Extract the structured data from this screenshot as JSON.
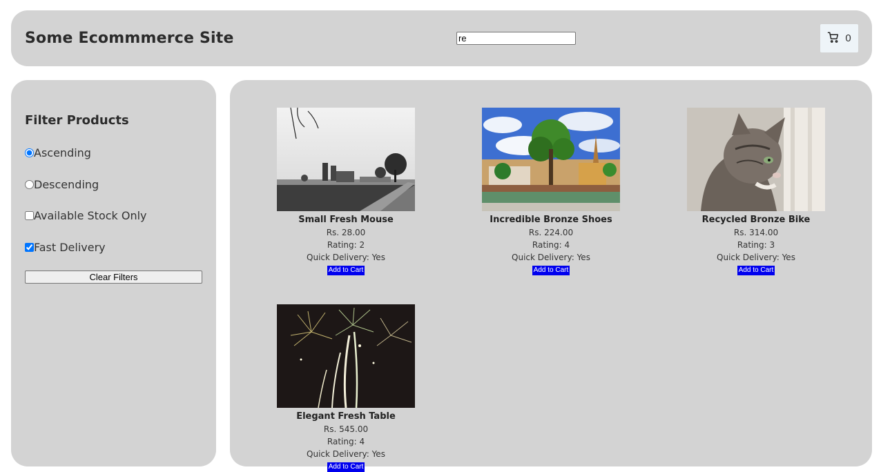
{
  "header": {
    "title": "Some Ecommmerce Site",
    "search_value": "re",
    "cart_icon": "cart-icon",
    "cart_count": "0"
  },
  "sidebar": {
    "title": "Filter Products",
    "options": [
      {
        "label": "Ascending",
        "type": "radio",
        "checked": true
      },
      {
        "label": "Descending",
        "type": "radio",
        "checked": false
      },
      {
        "label": "Available Stock Only",
        "type": "checkbox",
        "checked": false
      },
      {
        "label": "Fast Delivery",
        "type": "checkbox",
        "checked": true
      }
    ],
    "clear_label": "Clear Filters"
  },
  "products": [
    {
      "name": "Small Fresh Mouse",
      "price": "Rs. 28.00",
      "rating": "Rating: 2",
      "delivery": "Quick Delivery: Yes",
      "button": "Add to Cart",
      "image": "farm-landscape-photo"
    },
    {
      "name": "Incredible Bronze Shoes",
      "price": "Rs. 224.00",
      "rating": "Rating: 4",
      "delivery": "Quick Delivery: Yes",
      "button": "Add to Cart",
      "image": "city-tree-photo"
    },
    {
      "name": "Recycled Bronze Bike",
      "price": "Rs. 314.00",
      "rating": "Rating: 3",
      "delivery": "Quick Delivery: Yes",
      "button": "Add to Cart",
      "image": "cat-photo"
    },
    {
      "name": "Elegant Fresh Table",
      "price": "Rs. 545.00",
      "rating": "Rating: 4",
      "delivery": "Quick Delivery: Yes",
      "button": "Add to Cart",
      "image": "fireworks-photo"
    }
  ],
  "colors": {
    "panel": "#d3d3d3",
    "add_button": "#0000ee",
    "cart_bg": "#eef4f8"
  }
}
